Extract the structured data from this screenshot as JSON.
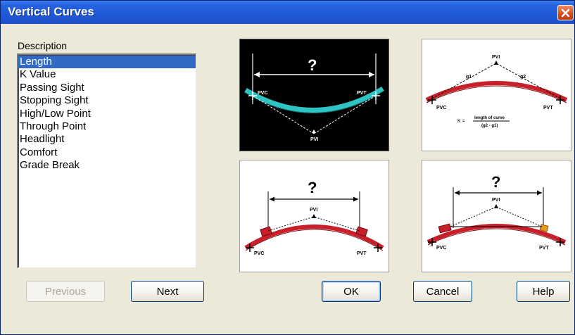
{
  "window": {
    "title": "Vertical Curves",
    "close_icon": "close-icon"
  },
  "description": {
    "label": "Description",
    "items": [
      {
        "label": "Length",
        "selected": true
      },
      {
        "label": "K Value",
        "selected": false
      },
      {
        "label": "Passing Sight",
        "selected": false
      },
      {
        "label": "Stopping Sight",
        "selected": false
      },
      {
        "label": "High/Low Point",
        "selected": false
      },
      {
        "label": "Through Point",
        "selected": false
      },
      {
        "label": "Headlight",
        "selected": false
      },
      {
        "label": "Comfort",
        "selected": false
      },
      {
        "label": "Grade Break",
        "selected": false
      }
    ]
  },
  "diagrams": {
    "sag_length": {
      "question": "?",
      "pvc": "PVC",
      "pvt": "PVT",
      "pvi": "PVI"
    },
    "k_value": {
      "pvi": "PVI",
      "g1": "g1",
      "g2": "g2",
      "pvc": "PVC",
      "pvt": "PVT",
      "formula_k": "K =",
      "formula_num": "length of curve",
      "formula_den": "(g2 - g1)"
    },
    "crest_sight": {
      "question": "?",
      "pvi": "PVI",
      "pvc": "PVC",
      "pvt": "PVT"
    },
    "crest_length": {
      "question": "?",
      "pvi": "PVI",
      "pvc": "PVC",
      "pvt": "PVT"
    }
  },
  "buttons": {
    "previous": "Previous",
    "next": "Next",
    "ok": "OK",
    "cancel": "Cancel",
    "help": "Help"
  },
  "colors": {
    "titlebar": "#2663e0",
    "selection": "#316ac5",
    "sag_curve": "#2ec4c4",
    "crest_curve": "#c8202a"
  }
}
